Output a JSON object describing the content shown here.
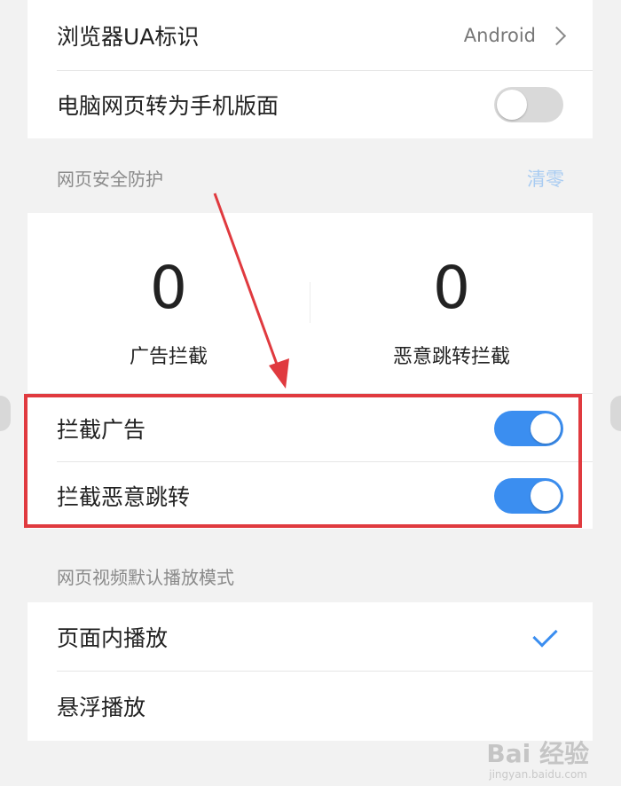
{
  "browser_settings": {
    "ua_label": "浏览器UA标识",
    "ua_value": "Android",
    "desktop_to_mobile_label": "电脑网页转为手机版面",
    "desktop_to_mobile_enabled": false
  },
  "security": {
    "title": "网页安全防护",
    "clear_label": "清零",
    "ad_block_count": "0",
    "ad_block_label": "广告拦截",
    "redirect_block_count": "0",
    "redirect_block_label": "恶意跳转拦截",
    "block_ads_label": "拦截广告",
    "block_ads_enabled": true,
    "block_redirects_label": "拦截恶意跳转",
    "block_redirects_enabled": true
  },
  "video": {
    "title": "网页视频默认播放模式",
    "options": [
      {
        "label": "页面内播放",
        "selected": true
      },
      {
        "label": "悬浮播放",
        "selected": false
      }
    ]
  },
  "watermark": {
    "text": "Bai 经验",
    "sub": "jingyan.baidu.com"
  },
  "colors": {
    "accent": "#3b8ef0",
    "highlight_border": "#e03a3f",
    "background": "#f2f2f2"
  }
}
